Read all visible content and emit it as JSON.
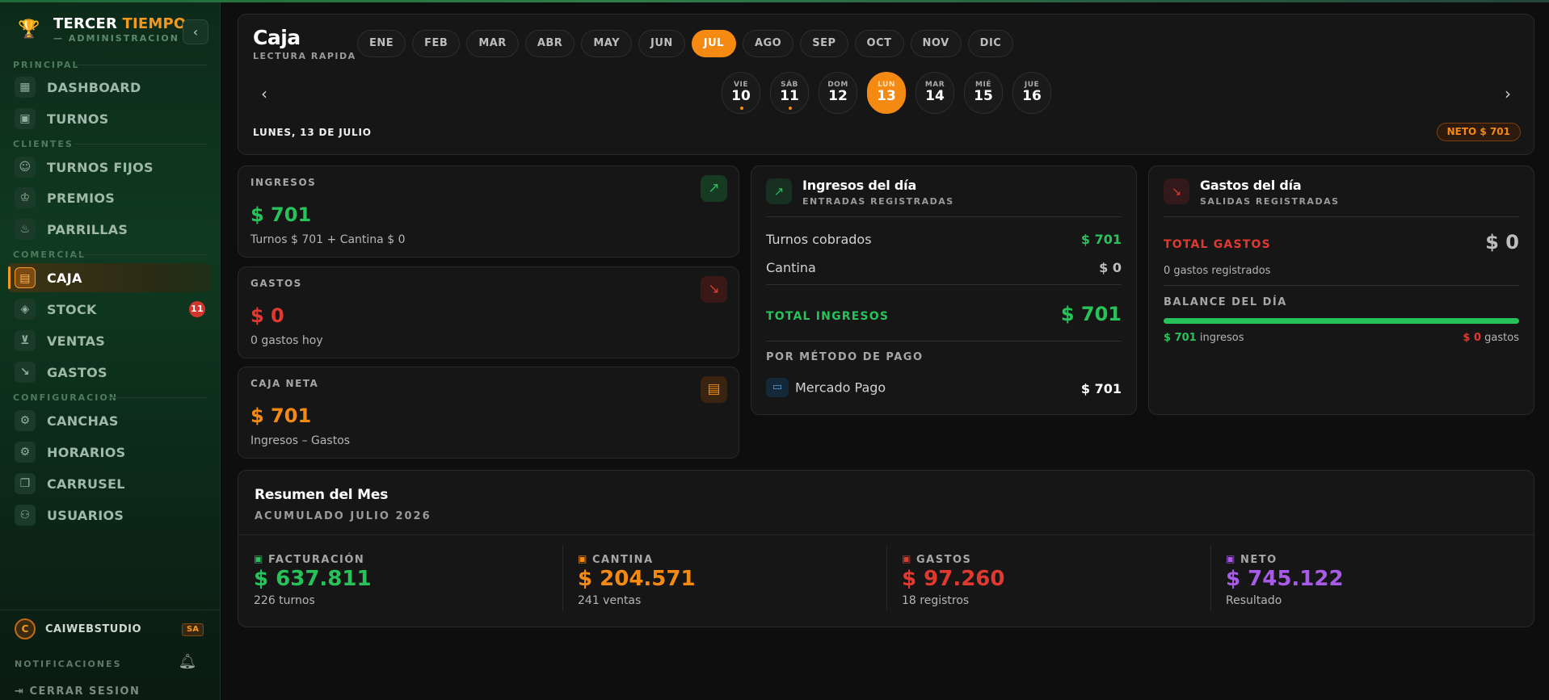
{
  "app": {
    "title_white": "TERCER",
    "title_accent": "TIEMPO",
    "subtitle": "— ADMINISTRACION"
  },
  "sidebar": {
    "sections": {
      "principal": "PRINCIPAL",
      "clientes": "CLIENTES",
      "comercial": "COMERCIAL",
      "configuracion": "CONFIGURACION"
    },
    "items": [
      {
        "label": "DASHBOARD",
        "icon": "grid-icon"
      },
      {
        "label": "TURNOS",
        "icon": "calendar-icon"
      },
      {
        "label": "TURNOS FIJOS",
        "icon": "users-icon"
      },
      {
        "label": "PREMIOS",
        "icon": "trophy-icon"
      },
      {
        "label": "PARRILLAS",
        "icon": "flame-icon"
      },
      {
        "label": "CAJA",
        "icon": "wallet-icon",
        "active": true
      },
      {
        "label": "STOCK",
        "icon": "box-icon",
        "badge": "11"
      },
      {
        "label": "VENTAS",
        "icon": "cart-icon"
      },
      {
        "label": "GASTOS",
        "icon": "trend-down-icon"
      },
      {
        "label": "CANCHAS",
        "icon": "gear-icon"
      },
      {
        "label": "HORARIOS",
        "icon": "gear-icon"
      },
      {
        "label": "CARRUSEL",
        "icon": "images-icon"
      },
      {
        "label": "USUARIOS",
        "icon": "user-gear-icon"
      }
    ],
    "user": {
      "initial": "C",
      "name": "CAIWEBSTUDIO",
      "role": "SA"
    },
    "notifications": "NOTIFICACIONES",
    "logout": "CERRAR SESION"
  },
  "header": {
    "title": "Caja",
    "subtitle": "LECTURA RAPIDA",
    "months": [
      "ENE",
      "FEB",
      "MAR",
      "ABR",
      "MAY",
      "JUN",
      "JUL",
      "AGO",
      "SEP",
      "OCT",
      "NOV",
      "DIC"
    ],
    "selected_month": "JUL",
    "days": [
      {
        "name": "VIE",
        "num": "10",
        "dot": true
      },
      {
        "name": "SÁB",
        "num": "11",
        "dot": true
      },
      {
        "name": "DOM",
        "num": "12",
        "dot": false
      },
      {
        "name": "LUN",
        "num": "13",
        "dot": false,
        "selected": true
      },
      {
        "name": "MAR",
        "num": "14",
        "dot": false
      },
      {
        "name": "MIÉ",
        "num": "15",
        "dot": false
      },
      {
        "name": "JUE",
        "num": "16",
        "dot": false
      }
    ],
    "date_label": "LUNES, 13 DE JULIO",
    "neto_pill": "NETO $ 701"
  },
  "stats": {
    "ingresos": {
      "title": "INGRESOS",
      "value": "$ 701",
      "sub": "Turnos $ 701 + Cantina $ 0"
    },
    "gastos": {
      "title": "GASTOS",
      "value": "$ 0",
      "sub": "0 gastos hoy"
    },
    "neta": {
      "title": "CAJA NETA",
      "value": "$ 701",
      "sub": "Ingresos – Gastos"
    }
  },
  "ingresos_dia": {
    "title": "Ingresos del día",
    "subtitle": "ENTRADAS REGISTRADAS",
    "rows": [
      {
        "label": "Turnos cobrados",
        "value": "$ 701"
      },
      {
        "label": "Cantina",
        "value": "$ 0"
      }
    ],
    "total_label": "TOTAL INGRESOS",
    "total_value": "$ 701",
    "method_title": "POR MÉTODO DE PAGO",
    "method": {
      "label": "Mercado Pago",
      "value": "$ 701"
    }
  },
  "gastos_dia": {
    "title": "Gastos del día",
    "subtitle": "SALIDAS REGISTRADAS",
    "total_label": "TOTAL GASTOS",
    "total_value": "$ 0",
    "count": "0 gastos registrados",
    "balance_title": "BALANCE DEL DÍA",
    "balance_ingresos_fraction": 1.0,
    "ing_value": "$ 701",
    "ing_label": "ingresos",
    "gas_value": "$ 0",
    "gas_label": "gastos"
  },
  "resumen": {
    "title": "Resumen del Mes",
    "subtitle": "ACUMULADO JULIO 2026",
    "kpis": [
      {
        "label": "FACTURACIÓN",
        "value": "$ 637.811",
        "sub": "226 turnos",
        "color": "#27c25a"
      },
      {
        "label": "CANTINA",
        "value": "$ 204.571",
        "sub": "241 ventas",
        "color": "#f58a12"
      },
      {
        "label": "GASTOS",
        "value": "$ 97.260",
        "sub": "18 registros",
        "color": "#e0392f"
      },
      {
        "label": "NETO",
        "value": "$ 745.122",
        "sub": "Resultado",
        "color": "#a85ae8"
      }
    ]
  }
}
